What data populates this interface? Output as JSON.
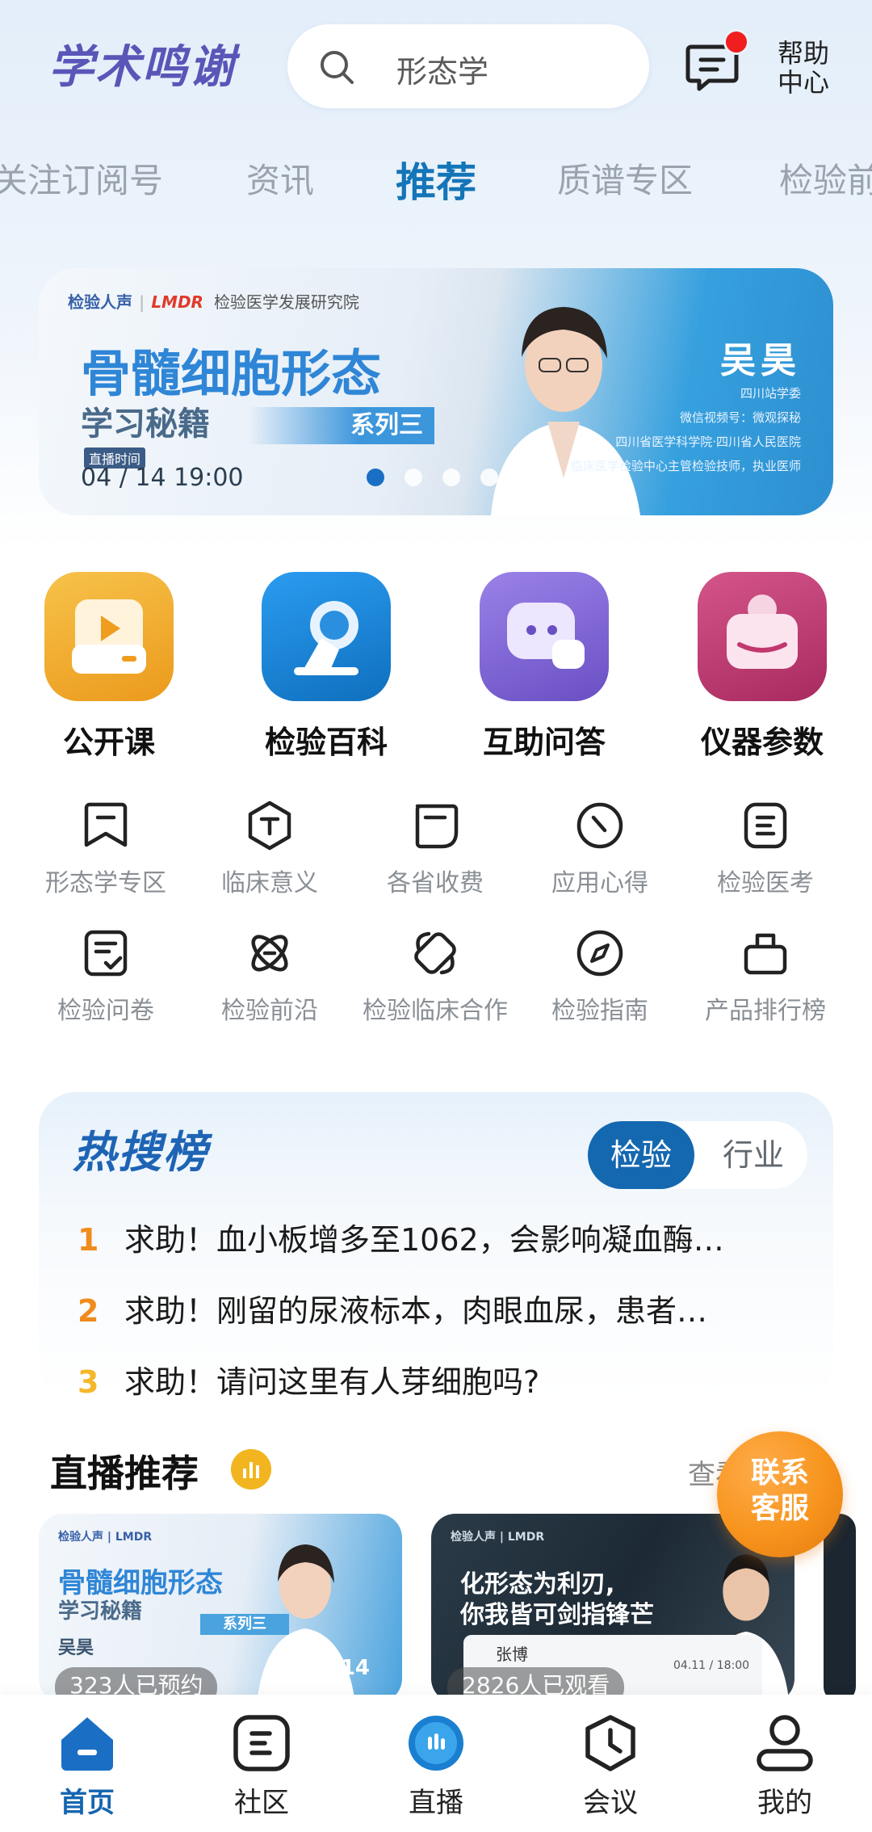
{
  "header": {
    "logo": "学术鸣谢",
    "search_placeholder": "形态学",
    "help_line1": "帮助",
    "help_line2": "中心"
  },
  "tabs": [
    "关注订阅号",
    "资讯",
    "推荐",
    "质谱专区",
    "检验前"
  ],
  "banner": {
    "brand_left": "检验人声",
    "brand_right": "LMDR",
    "brand_org": "检验医学发展研究院",
    "title": "骨髓细胞形态",
    "subtitle": "学习秘籍",
    "series": "系列三",
    "live_label": "直播时间",
    "live_time": "04 / 14 19:00",
    "lecturer": "吴昊",
    "info": [
      "四川站学委",
      "微信视频号：微观探秘",
      "四川省医学科学院·四川省人民医院",
      "临床医学检验中心主管检验技师，执业医师"
    ]
  },
  "apps": [
    {
      "label": "公开课",
      "icon": "video-course-icon",
      "color": "#f1a92a"
    },
    {
      "label": "检验百科",
      "icon": "microscope-icon",
      "color": "#1b86d8"
    },
    {
      "label": "互助问答",
      "icon": "chat-bubbles-icon",
      "color": "#7b62d0"
    },
    {
      "label": "仪器参数",
      "icon": "instrument-icon",
      "color": "#c2386e"
    }
  ],
  "grid": [
    {
      "label": "形态学专区",
      "icon": "bookmark-icon"
    },
    {
      "label": "临床意义",
      "icon": "hexagon-t-icon"
    },
    {
      "label": "各省收费",
      "icon": "tag-icon"
    },
    {
      "label": "应用心得",
      "icon": "clock-icon"
    },
    {
      "label": "检验医考",
      "icon": "doc-list-icon"
    },
    {
      "label": "检验问卷",
      "icon": "checklist-icon"
    },
    {
      "label": "检验前沿",
      "icon": "orbit-icon"
    },
    {
      "label": "检验临床合作",
      "icon": "handshake-icon"
    },
    {
      "label": "检验指南",
      "icon": "compass-icon"
    },
    {
      "label": "产品排行榜",
      "icon": "box-icon"
    }
  ],
  "hot": {
    "title": "热搜榜",
    "tab_active": "检验",
    "tab_other": "行业",
    "items": [
      {
        "rank": "1",
        "text": "求助！血小板增多至1062，会影响凝血酶…"
      },
      {
        "rank": "2",
        "text": "求助！刚留的尿液标本，肉眼血尿，患者…"
      },
      {
        "rank": "3",
        "text": "求助！请问这里有人芽细胞吗?"
      }
    ]
  },
  "live": {
    "heading": "直播推荐",
    "more": "查看",
    "cards": [
      {
        "brand": "检验人声 | LMDR",
        "title": "骨髓细胞形态",
        "sub": "学习秘籍",
        "series": "系列三",
        "name": "吴昊",
        "count": "323人已预约",
        "date": "04 / 14"
      },
      {
        "brand": "检验人声 | LMDR",
        "title": "化形态为利刃,",
        "sub": "你我皆可剑指锋芒",
        "speaker": "张博",
        "count": "2826人已观看",
        "date": "04.11 / 18:00"
      }
    ]
  },
  "contact": {
    "line1": "联系",
    "line2": "客服"
  },
  "bottom_nav": [
    {
      "label": "首页",
      "icon": "home-icon",
      "active": true
    },
    {
      "label": "社区",
      "icon": "community-icon",
      "active": false
    },
    {
      "label": "直播",
      "icon": "live-icon",
      "active": false
    },
    {
      "label": "会议",
      "icon": "meeting-clock-icon",
      "active": false
    },
    {
      "label": "我的",
      "icon": "profile-icon",
      "active": false
    }
  ]
}
